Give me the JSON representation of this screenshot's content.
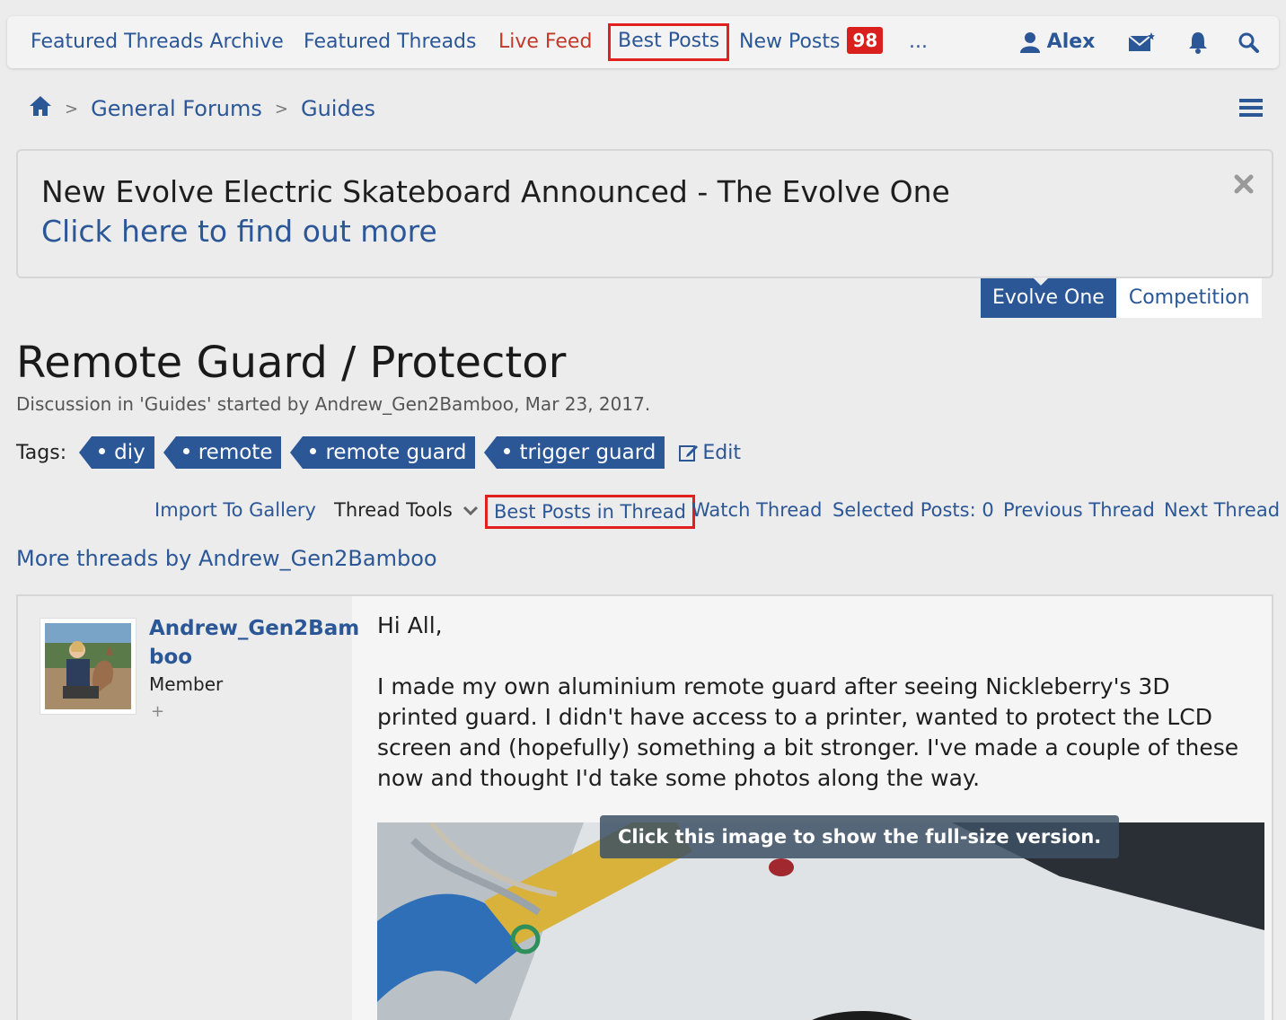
{
  "nav": {
    "items": [
      {
        "label": "Featured Threads Archive"
      },
      {
        "label": "Featured Threads"
      },
      {
        "label": "Live Feed"
      },
      {
        "label": "Best Posts"
      },
      {
        "label": "New Posts",
        "badge": "98"
      },
      {
        "label": "..."
      }
    ],
    "user": "Alex",
    "icons": [
      "user-icon",
      "mail-icon",
      "bell-icon",
      "search-icon"
    ]
  },
  "breadcrumb": [
    "General Forums",
    "Guides"
  ],
  "notice": {
    "title": "New Evolve Electric Skateboard Announced - The Evolve One",
    "link": "Click here to find out more",
    "tabs": [
      "Evolve One",
      "Competition"
    ]
  },
  "thread": {
    "title": "Remote Guard / Protector",
    "meta": "Discussion in 'Guides' started by Andrew_Gen2Bamboo, Mar 23, 2017.",
    "tags_label": "Tags:",
    "tags": [
      "diy",
      "remote",
      "remote guard",
      "trigger guard"
    ],
    "tags_edit": "Edit"
  },
  "toolbar": {
    "import": "Import To Gallery",
    "tools": "Thread Tools",
    "best": "Best Posts in Thread",
    "watch": "Watch Thread",
    "selected": "Selected Posts: 0",
    "prev": "Previous Thread",
    "next": "Next Thread"
  },
  "more_threads": "More threads by Andrew_Gen2Bamboo",
  "post": {
    "author_line1": "Andrew_Gen2Bam",
    "author_line2": "boo",
    "author_title": "Member",
    "author_extra": "+",
    "greeting": "Hi All,",
    "body": "I made my own aluminium remote guard after seeing Nickleberry's 3D printed guard. I didn't have access to a printer, wanted to protect the LCD screen and (hopefully) something a bit stronger. I've made a couple of these now and thought I'd take some photos along the way.",
    "image_hint": "Click this image to show the full-size version."
  },
  "colors": {
    "accent": "#2b5797",
    "live": "#c0392b",
    "highlight": "#e0201c",
    "badge": "#d9201c"
  }
}
